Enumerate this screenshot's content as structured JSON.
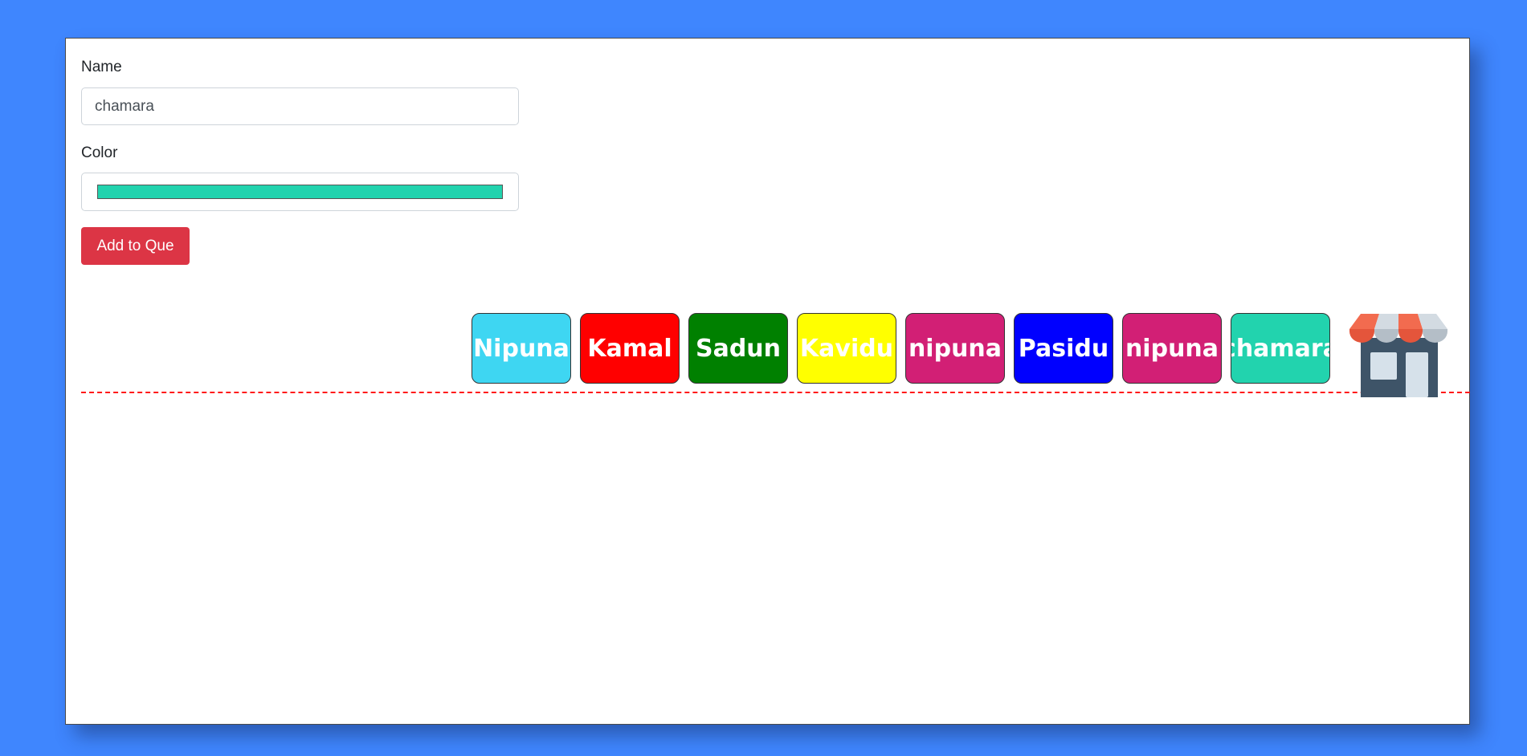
{
  "form": {
    "name_label": "Name",
    "name_value": "chamara",
    "color_label": "Color",
    "color_value": "#22d3ae",
    "submit_label": "Add to Que"
  },
  "queue": {
    "items": [
      {
        "label": "Nipuna",
        "color": "#3ed6f2"
      },
      {
        "label": "Kamal",
        "color": "#ff0000"
      },
      {
        "label": "Sadun",
        "color": "#008000"
      },
      {
        "label": "Kavidu",
        "color": "#ffff00"
      },
      {
        "label": "nipuna",
        "color": "#d21f75"
      },
      {
        "label": "Pasidu",
        "color": "#0000ff"
      },
      {
        "label": "nipuna",
        "color": "#d21f75"
      },
      {
        "label": "chamara",
        "color": "#22d3ae"
      }
    ],
    "line_color": "#ff1a1a",
    "destination_icon": "shop-icon"
  },
  "colors": {
    "background": "#3f86fe",
    "button": "#dc3545"
  }
}
